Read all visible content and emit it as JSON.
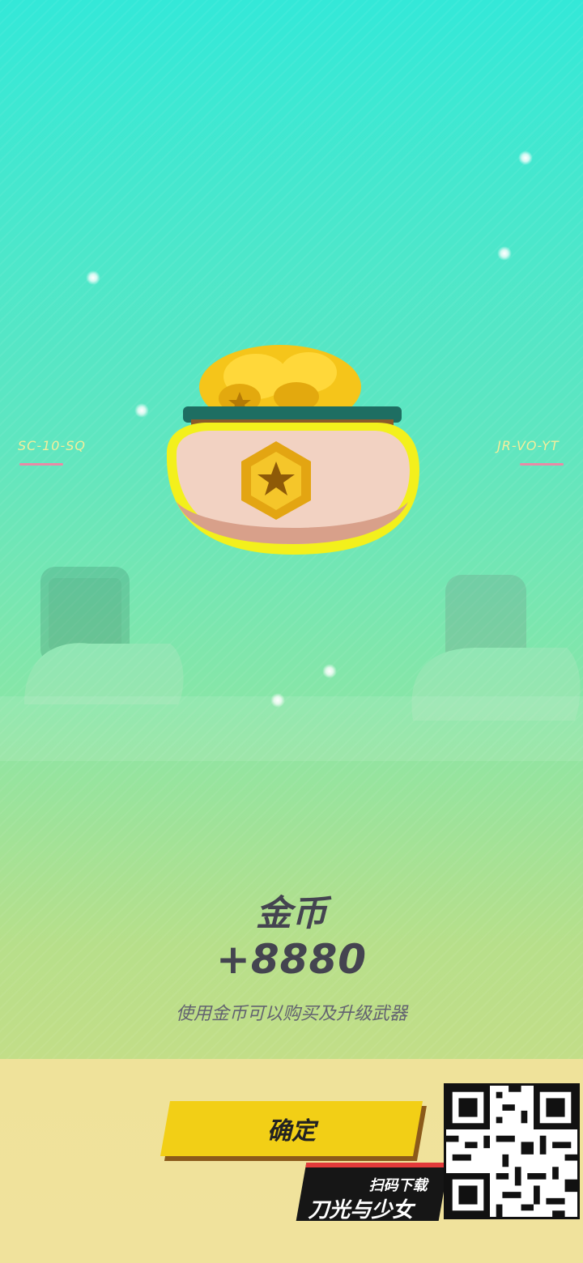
{
  "reward": {
    "title": "金币",
    "amount": "+8880",
    "description": "使用金币可以购买及升级武器"
  },
  "side_labels": {
    "left": "SC-10-SQ",
    "right": "JR-VO-YT"
  },
  "buttons": {
    "confirm_label": "确定"
  },
  "promo": {
    "scan_text": "扫码下载",
    "game_name": "刀光与少女"
  },
  "icons": [
    "coin-pot-icon",
    "star-badge-icon",
    "sparkle-icon",
    "qr-code"
  ],
  "colors": {
    "button": "#f2cf16",
    "text": "#444450",
    "label": "#f4ee9c"
  }
}
